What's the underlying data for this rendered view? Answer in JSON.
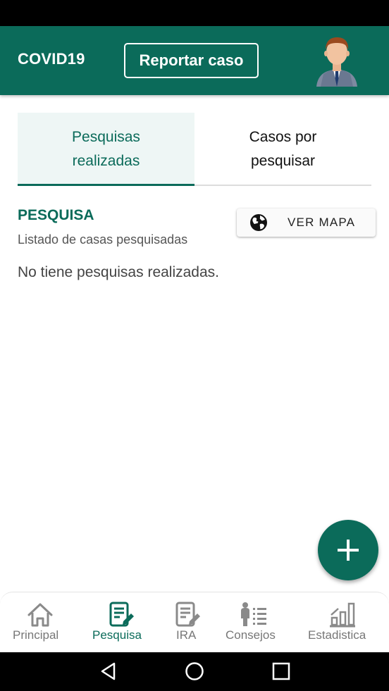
{
  "app_bar": {
    "title": "COVID19",
    "report_button": "Reportar caso",
    "avatar_icon": "user-avatar-icon",
    "color": "#0b6b5a"
  },
  "tabs": [
    {
      "label_line1": "Pesquisas",
      "label_line2": "realizadas",
      "active": true
    },
    {
      "label_line1": "Casos por",
      "label_line2": "pesquisar",
      "active": false
    }
  ],
  "section": {
    "title": "PESQUISA",
    "subtitle": "Listado de casas pesquisadas",
    "map_button": "VER MAPA",
    "map_icon": "globe-icon",
    "empty_message": "No tiene pesquisas realizadas."
  },
  "fab": {
    "icon": "plus-icon"
  },
  "bottom_nav": [
    {
      "label": "Principal",
      "icon": "home-icon",
      "active": false
    },
    {
      "label": "Pesquisa",
      "icon": "survey-edit-icon",
      "active": true
    },
    {
      "label": "IRA",
      "icon": "document-edit-icon",
      "active": false
    },
    {
      "label": "Consejos",
      "icon": "advice-list-icon",
      "active": false
    },
    {
      "label": "Estadistica",
      "icon": "bar-chart-icon",
      "active": false
    }
  ],
  "system_nav": {
    "back": "back-icon",
    "home": "home-circle-icon",
    "recents": "recents-icon"
  }
}
